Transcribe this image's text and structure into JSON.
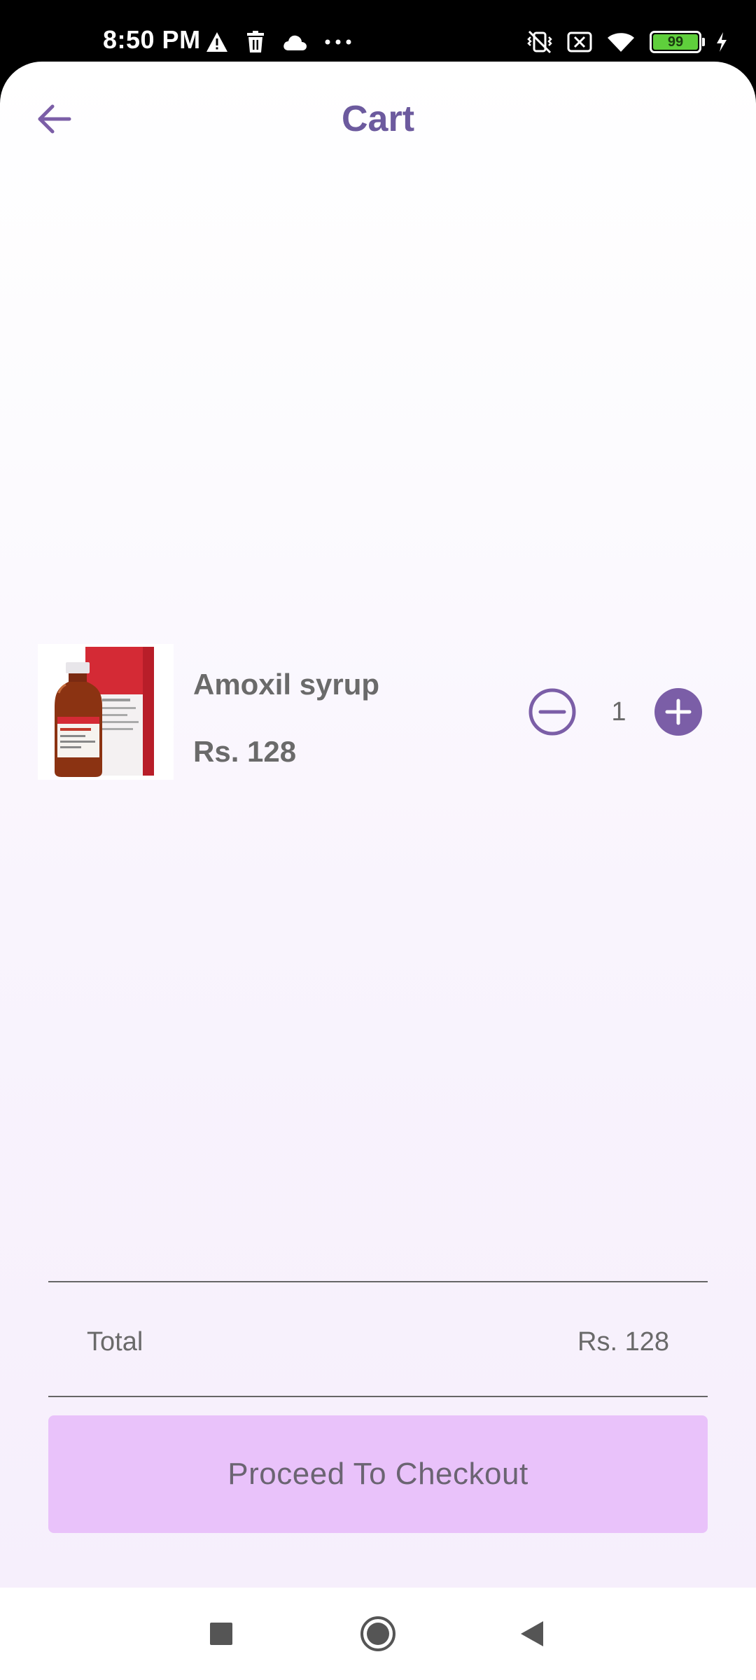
{
  "status_bar": {
    "time": "8:50 PM",
    "battery_level": "99",
    "left_icons": [
      "warning-icon",
      "trash-icon",
      "cloud-icon",
      "more-dots-icon"
    ],
    "right_icons": [
      "vibrate-off-icon",
      "sim-off-icon",
      "wifi-icon",
      "battery-icon",
      "charging-icon"
    ]
  },
  "header": {
    "title": "Cart",
    "back_icon": "arrow-left-icon"
  },
  "cart": {
    "items": [
      {
        "name": "Amoxil syrup",
        "price": "Rs. 128",
        "quantity": "1",
        "image_label": "Amoxil Forte"
      }
    ]
  },
  "summary": {
    "total_label": "Total",
    "total_value": "Rs. 128"
  },
  "checkout": {
    "label": "Proceed To Checkout"
  },
  "colors": {
    "accent": "#7b5ea7",
    "title": "#6c5a9e",
    "checkout_bg": "#e9c2fa",
    "text": "#6a6a6a"
  },
  "nav_bar": {
    "icons": [
      "recents-square-icon",
      "home-circle-icon",
      "back-triangle-icon"
    ]
  }
}
